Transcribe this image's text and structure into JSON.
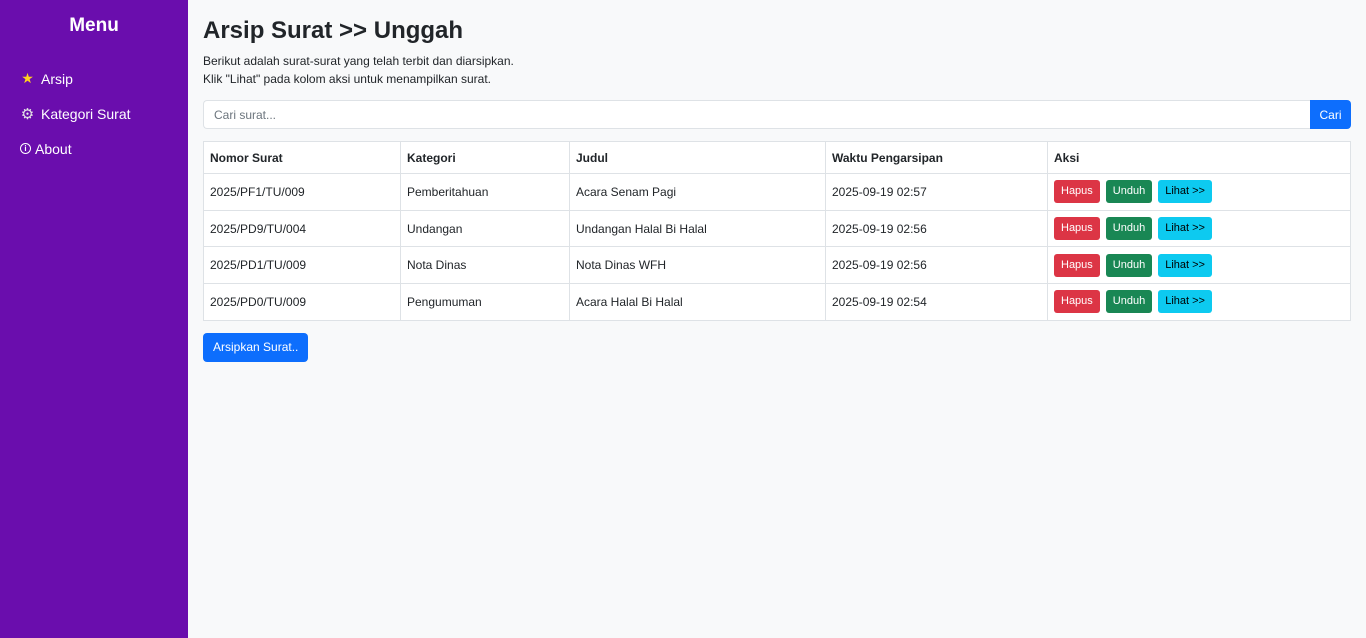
{
  "sidebar": {
    "title": "Menu",
    "items": [
      {
        "label": "Arsip",
        "icon": "star-icon"
      },
      {
        "label": "Kategori Surat",
        "icon": "gear-icon"
      },
      {
        "label": "About",
        "icon": "info-icon"
      }
    ]
  },
  "page": {
    "title": "Arsip Surat >> Unggah",
    "desc_line1": "Berikut adalah surat-surat yang telah terbit dan diarsipkan.",
    "desc_line2": "Klik \"Lihat\" pada kolom aksi untuk menampilkan surat."
  },
  "search": {
    "placeholder": "Cari surat...",
    "button_label": "Cari"
  },
  "table": {
    "headers": [
      "Nomor Surat",
      "Kategori",
      "Judul",
      "Waktu Pengarsipan",
      "Aksi"
    ],
    "rows": [
      {
        "nomor": "2025/PF1/TU/009",
        "kategori": "Pemberitahuan",
        "judul": "Acara Senam Pagi",
        "waktu": "2025-09-19 02:57"
      },
      {
        "nomor": "2025/PD9/TU/004",
        "kategori": "Undangan",
        "judul": "Undangan Halal Bi Halal",
        "waktu": "2025-09-19 02:56"
      },
      {
        "nomor": "2025/PD1/TU/009",
        "kategori": "Nota Dinas",
        "judul": "Nota Dinas WFH",
        "waktu": "2025-09-19 02:56"
      },
      {
        "nomor": "2025/PD0/TU/009",
        "kategori": "Pengumuman",
        "judul": "Acara Halal Bi Halal",
        "waktu": "2025-09-19 02:54"
      }
    ],
    "actions": {
      "delete": "Hapus",
      "download": "Unduh",
      "view": "Lihat >>"
    }
  },
  "archive_button": "Arsipkan Surat..",
  "colors": {
    "sidebar": "#6a0dad",
    "primary": "#0d6efd",
    "danger": "#dc3545",
    "success": "#198754",
    "info": "#0dcaf0"
  }
}
